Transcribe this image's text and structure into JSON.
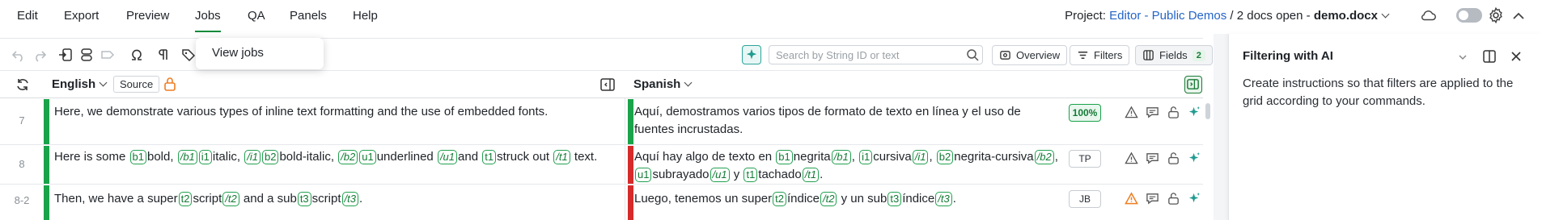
{
  "menu": {
    "items": [
      "Edit",
      "Export",
      "Preview",
      "Jobs",
      "QA",
      "Panels",
      "Help"
    ],
    "active": "Jobs"
  },
  "project": {
    "label": "Project:",
    "name": "Editor - Public Demos",
    "separator": "/",
    "docs_open": "2 docs open -",
    "current_doc": "demo.docx"
  },
  "toolbar": {
    "search_placeholder": "Search by String ID or text",
    "overview_label": "Overview",
    "filters_label": "Filters",
    "fields_label": "Fields",
    "fields_count": "2"
  },
  "jobs_menu": {
    "items": [
      "View jobs"
    ]
  },
  "columns": {
    "source_language": "English",
    "source_chip": "Source",
    "target_language": "Spanish"
  },
  "rows": [
    {
      "num": "7",
      "status": "100%",
      "src_text": "Here, we demonstrate various types of inline text formatting and the use of embedded fonts.",
      "tgt_line1": "Aquí, demostramos varios tipos de formato de texto en línea y el uso de",
      "tgt_line2": "fuentes incrustadas."
    },
    {
      "num": "8",
      "status": "TP"
    },
    {
      "num": "8-2",
      "status": "JB"
    }
  ],
  "right_panel": {
    "title": "Filtering with AI",
    "description": "Create instructions so that filters are applied to the grid according to your commands."
  },
  "colors": {
    "accent_green": "#1aa34a",
    "error_red": "#d62b2b",
    "link_blue": "#2564c7",
    "warning_orange": "#ee7d22"
  }
}
